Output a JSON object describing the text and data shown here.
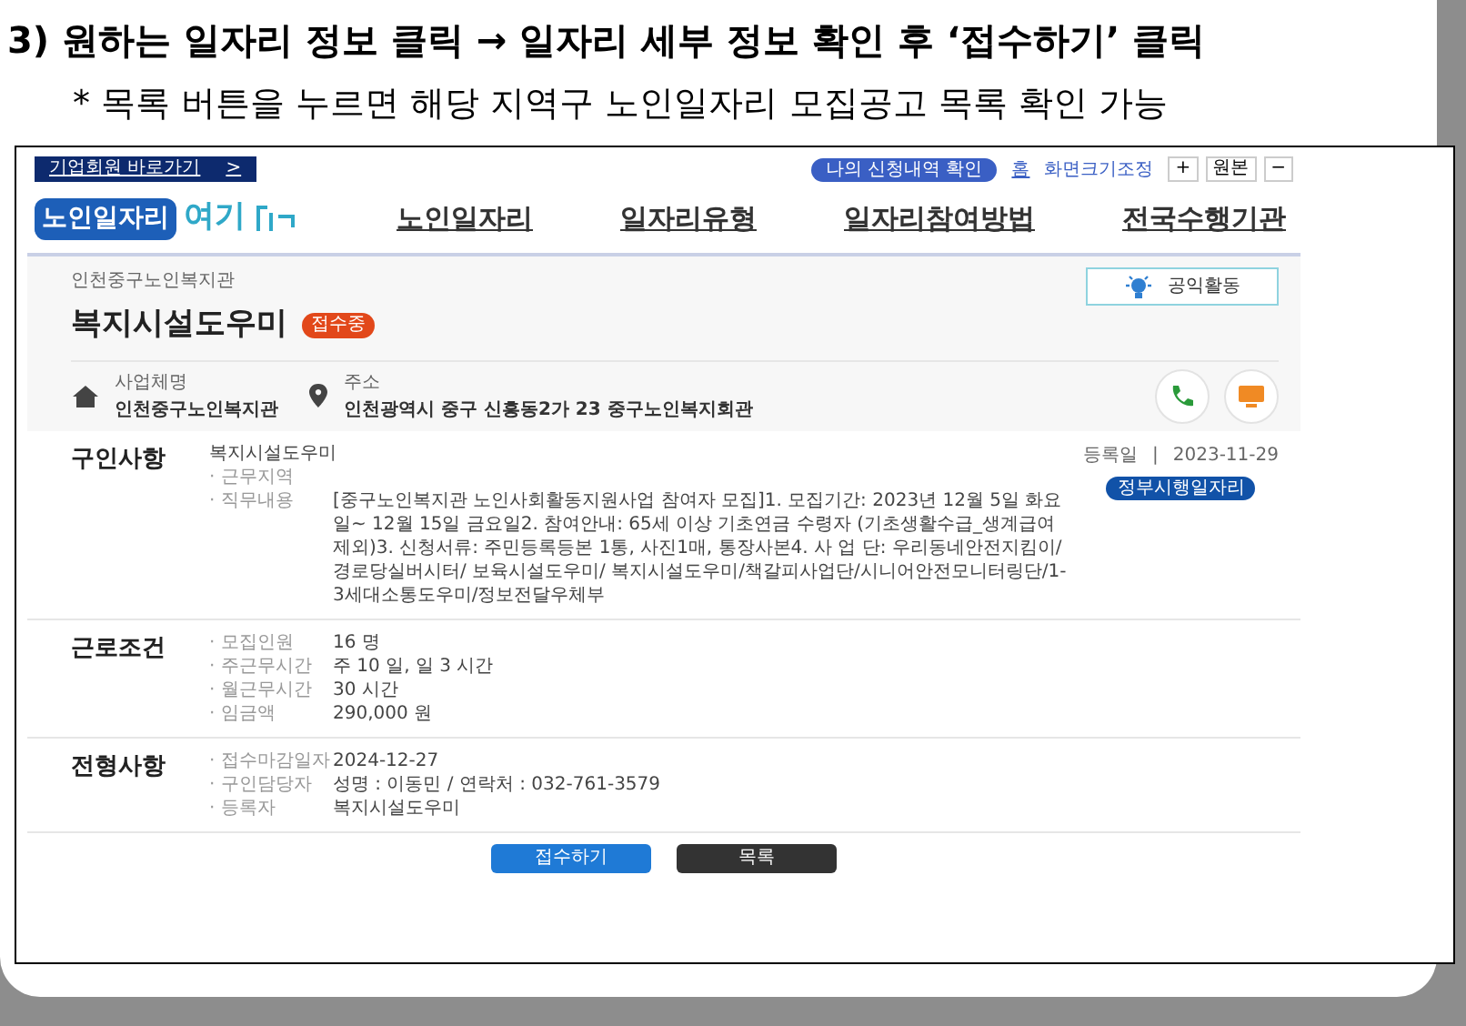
{
  "slide": {
    "title": "3) 원하는 일자리 정보 클릭 → 일자리 세부 정보 확인 후 ‘접수하기’ 클릭",
    "note": "* 목록 버튼을 누르면 해당 지역구 노인일자리 모집공고 목록 확인 가능"
  },
  "top_bar": {
    "member_link": "기업회원 바로가기",
    "member_arrow": ">",
    "my_apply_button": "나의 신청내역 확인",
    "home_link": "홈",
    "zoom_label": "화면크기조정",
    "zoom_buttons": [
      "+",
      "원본",
      "−"
    ]
  },
  "header": {
    "logo": {
      "part_1": "노인일자리",
      "part_2": "여기"
    },
    "nav": [
      {
        "label": "노인일자리"
      },
      {
        "label": "일자리유형"
      },
      {
        "label": "일자리참여방법"
      },
      {
        "label": "전국수행기관"
      }
    ]
  },
  "job": {
    "organization": "인천중구노인복지관",
    "title": "복지시설도우미",
    "status_badge": "접수중",
    "category_button": "공익활동",
    "info": [
      {
        "kind": "house",
        "label": "사업체명",
        "value": "인천중구노인복지관"
      },
      {
        "kind": "pin",
        "label": "주소",
        "value": "인천광역시 중구 신흥동2가 23 중구노인복지회관"
      }
    ]
  },
  "sections": [
    {
      "title": "구인사항",
      "heading": "복지시설도우미",
      "date_label": "등록일",
      "date_sep": "|",
      "date": "2023-11-29",
      "tag": "정부시행일자리",
      "rows": [
        {
          "label": "· 근무지역"
        },
        {
          "label": "· 직무내용",
          "value": "[중구노인복지관 노인사회활동지원사업 참여자 모집]1. 모집기간: 2023년 12월 5일 화요일~ 12월 15일 금요일2. 참여안내: 65세 이상 기초연금 수령자 (기초생활수급_생계급여 제외)3. 신청서류: 주민등록등본 1통, 사진1매, 통장사본4. 사 업 단: 우리동네안전지킴이/ 경로당실버시터/ 보육시설도우미/ 복지시설도우미/책갈피사업단/시니어안전모니터링단/1-3세대소통도우미/정보전달우체부"
        }
      ]
    },
    {
      "title": "근로조건",
      "rows": [
        {
          "label": "· 모집인원",
          "value": "16 명"
        },
        {
          "label": "· 주근무시간",
          "value": "주 10 일, 일 3 시간"
        },
        {
          "label": "· 월근무시간",
          "value": "30 시간"
        },
        {
          "label": "· 임금액",
          "value": "290,000 원"
        }
      ]
    },
    {
      "title": "전형사항",
      "rows": [
        {
          "label": "· 접수마감일자",
          "value": "2024-12-27"
        },
        {
          "label": "· 구인담당자",
          "value": "성명 : 이동민 / 연락처 : 032-761-3579"
        },
        {
          "label": "· 등록자",
          "value": "복지시설도우미"
        }
      ]
    }
  ],
  "buttons": [
    {
      "kind": "primary",
      "label": "접수하기"
    },
    {
      "kind": "dark",
      "label": "목록"
    }
  ]
}
